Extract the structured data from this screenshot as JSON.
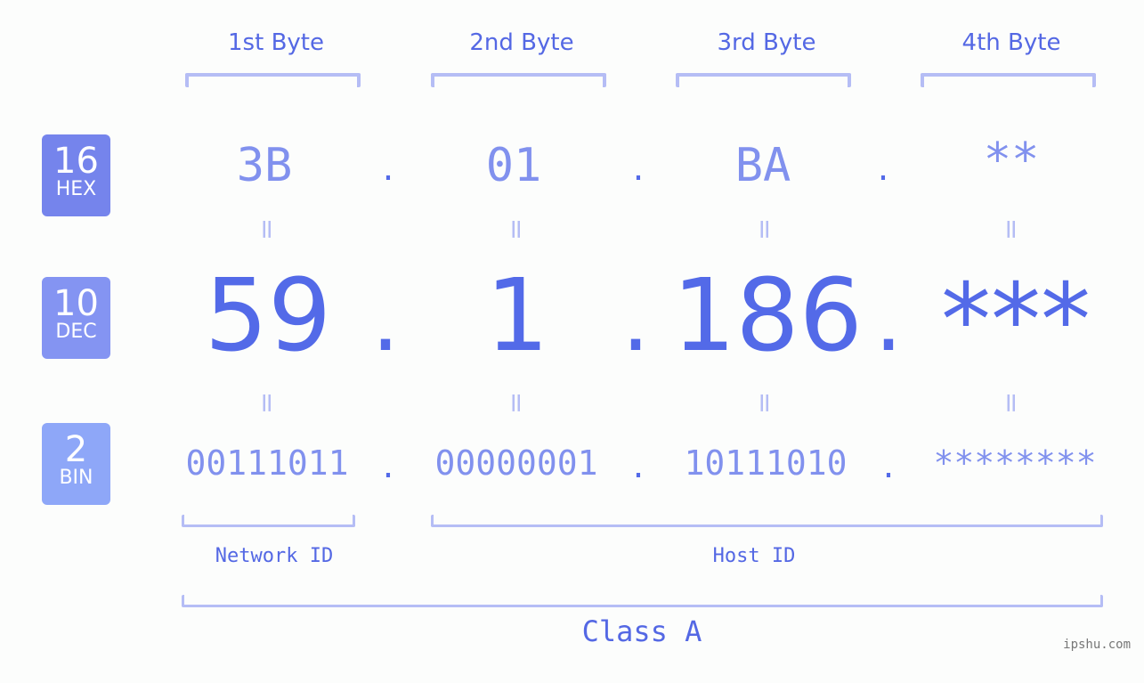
{
  "bytes": [
    {
      "title": "1st Byte",
      "hex": "3B",
      "dec": "59",
      "bin": "00111011"
    },
    {
      "title": "2nd Byte",
      "hex": "01",
      "dec": "1",
      "bin": "00000001"
    },
    {
      "title": "3rd Byte",
      "hex": "BA",
      "dec": "186",
      "bin": "10111010"
    },
    {
      "title": "4th Byte",
      "hex": "**",
      "dec": "***",
      "bin": "********"
    }
  ],
  "badges": {
    "hex": {
      "num": "16",
      "label": "HEX",
      "color": "#7584ec"
    },
    "dec": {
      "num": "10",
      "label": "DEC",
      "color": "#8494f2"
    },
    "bin": {
      "num": "2",
      "label": "BIN",
      "color": "#8ea7f8"
    }
  },
  "separator": ".",
  "equals": "=",
  "sections": {
    "network": "Network ID",
    "host": "Host ID"
  },
  "class_label": "Class A",
  "watermark": "ipshu.com",
  "colors": {
    "accent": "#536ae8",
    "light": "#8191ee",
    "bracket": "#b5bdf5"
  }
}
